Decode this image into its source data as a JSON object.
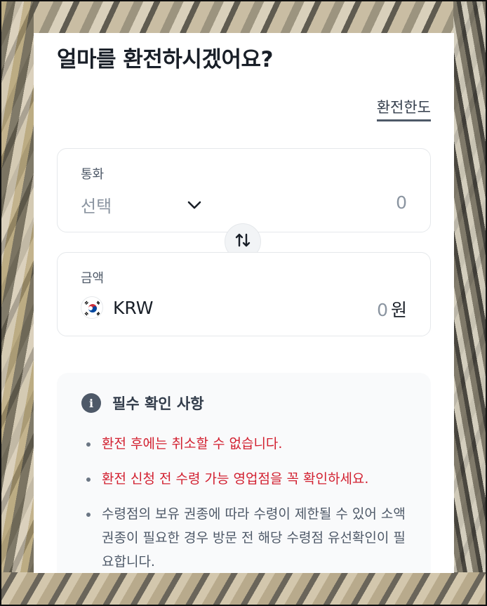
{
  "header": {
    "title": "얼마를 환전하시겠어요?",
    "limit_link": "환전한도"
  },
  "currency_card": {
    "label": "통화",
    "select_placeholder": "선택",
    "value": "0",
    "icon": "chevron-down-icon"
  },
  "swap": {
    "icon": "swap-arrows-icon"
  },
  "amount_card": {
    "label": "금액",
    "currency_code": "KRW",
    "flag_icon": "korea-flag-icon",
    "value": "0",
    "unit": "원"
  },
  "notice": {
    "title": "필수 확인 사항",
    "icon": "info-icon",
    "items": [
      {
        "text": "환전 후에는 취소할 수 없습니다.",
        "type": "warning"
      },
      {
        "text": "환전 신청 전 수령 가능 영업점을 꼭 확인하세요.",
        "type": "warning"
      },
      {
        "text": "수령점의 보유 권종에 따라 수령이 제한될 수 있어 소액권종이 필요한 경우 방문 전 해당 수령점 유선확인이 필요합니다.",
        "type": "normal"
      }
    ]
  },
  "colors": {
    "warning_text": "#d22030",
    "primary_text": "#191f28",
    "muted_text": "#8b95a1"
  }
}
